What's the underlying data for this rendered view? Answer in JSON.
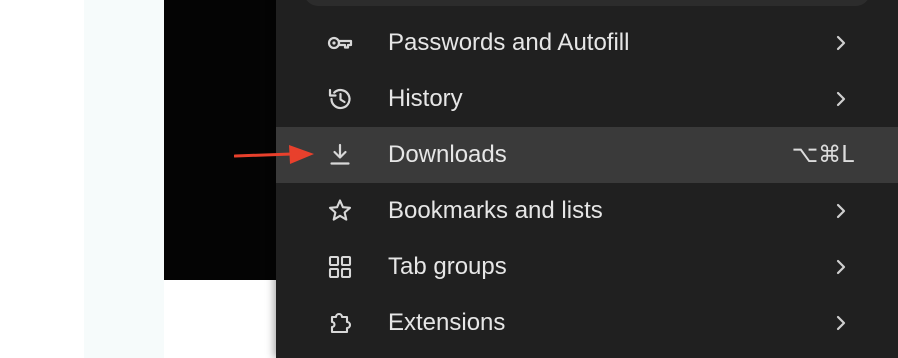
{
  "menu": {
    "items": [
      {
        "label": "Passwords and Autofill",
        "icon": "key-icon",
        "has_submenu": true,
        "shortcut": ""
      },
      {
        "label": "History",
        "icon": "history-icon",
        "has_submenu": true,
        "shortcut": ""
      },
      {
        "label": "Downloads",
        "icon": "download-icon",
        "has_submenu": false,
        "shortcut": "⌥⌘L",
        "highlighted": true
      },
      {
        "label": "Bookmarks and lists",
        "icon": "star-icon",
        "has_submenu": true,
        "shortcut": ""
      },
      {
        "label": "Tab groups",
        "icon": "tab-groups-icon",
        "has_submenu": true,
        "shortcut": ""
      },
      {
        "label": "Extensions",
        "icon": "extensions-icon",
        "has_submenu": true,
        "shortcut": ""
      }
    ]
  },
  "annotation": {
    "arrow_color": "#e8402c",
    "arrow_icon": "red-arrow-icon"
  },
  "colors": {
    "menu_background": "#202020",
    "highlight_background": "#3a3a3a",
    "text": "#e6e6e6"
  }
}
